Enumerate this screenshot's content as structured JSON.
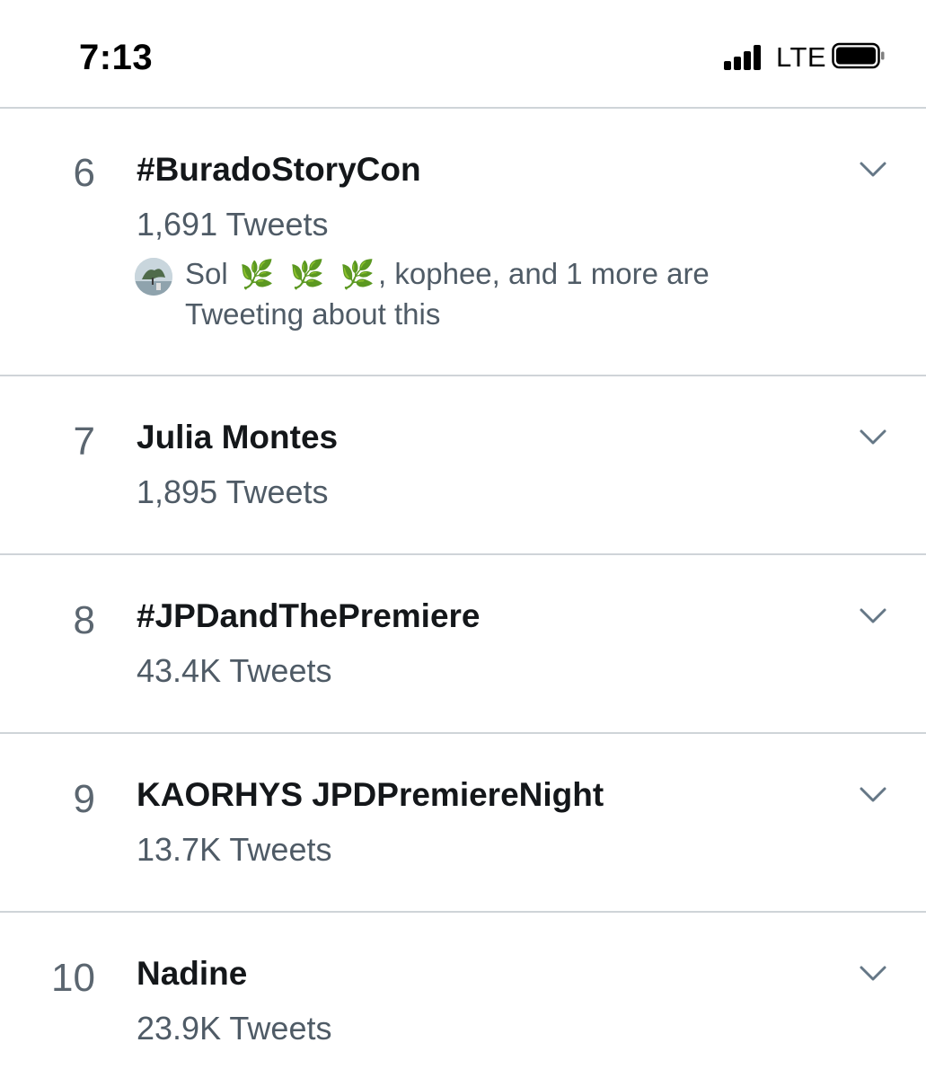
{
  "status_bar": {
    "time": "7:13",
    "network": "LTE",
    "signal_icon": "cellular-signal-icon",
    "battery_icon": "battery-icon"
  },
  "trends": [
    {
      "rank": "6",
      "name": "#BuradoStoryCon",
      "count": "1,691 Tweets",
      "social": {
        "avatar_icon": "user-avatar",
        "user": "Sol",
        "emoji": [
          "🌿",
          "🌿",
          "🌿"
        ],
        "suffix": ", kophee, and 1 more are",
        "line2": "Tweeting about this"
      }
    },
    {
      "rank": "7",
      "name": "Julia Montes",
      "count": "1,895 Tweets"
    },
    {
      "rank": "8",
      "name": "#JPDandThePremiere",
      "count": "43.4K Tweets"
    },
    {
      "rank": "9",
      "name": "KAORHYS JPDPremiereNight",
      "count": "13.7K Tweets"
    },
    {
      "rank": "10",
      "name": "Nadine",
      "count": "23.9K Tweets"
    }
  ],
  "colors": {
    "text_primary": "#14171a",
    "text_secondary": "#4f5b66",
    "divider": "#cfd4d8",
    "chevron": "#657786"
  }
}
